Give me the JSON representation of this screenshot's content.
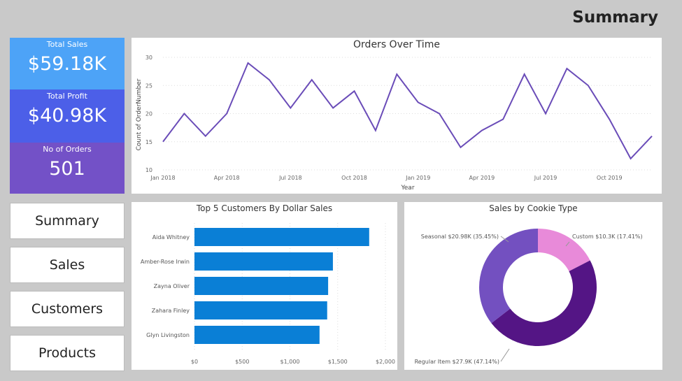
{
  "header": {
    "title": "Summary"
  },
  "kpis": [
    {
      "label": "Total Sales",
      "value": "$59.18K",
      "color": "#4da3f7"
    },
    {
      "label": "Total Profit",
      "value": "$40.98K",
      "color": "#4c5fe8"
    },
    {
      "label": "No of Orders",
      "value": "501",
      "color": "#7351c7"
    }
  ],
  "nav": [
    {
      "label": "Summary"
    },
    {
      "label": "Sales"
    },
    {
      "label": "Customers"
    },
    {
      "label": "Products"
    }
  ],
  "chart_data": [
    {
      "type": "line",
      "title": "Orders Over Time",
      "xlabel": "Year",
      "ylabel": "Count of OrderNumber",
      "ylim": [
        10,
        30
      ],
      "yticks": [
        10,
        15,
        20,
        25,
        30
      ],
      "grid": true,
      "color": "#6a4cb8",
      "x": [
        "Jan 2018",
        "Feb 2018",
        "Mar 2018",
        "Apr 2018",
        "May 2018",
        "Jun 2018",
        "Jul 2018",
        "Aug 2018",
        "Sep 2018",
        "Oct 2018",
        "Nov 2018",
        "Dec 2018",
        "Jan 2019",
        "Feb 2019",
        "Mar 2019",
        "Apr 2019",
        "May 2019",
        "Jun 2019",
        "Jul 2019",
        "Aug 2019",
        "Sep 2019",
        "Oct 2019",
        "Nov 2019",
        "Dec 2019"
      ],
      "xticks": [
        "Jan 2018",
        "Apr 2018",
        "Jul 2018",
        "Oct 2018",
        "Jan 2019",
        "Apr 2019",
        "Jul 2019",
        "Oct 2019"
      ],
      "values": [
        15,
        20,
        16,
        20,
        29,
        26,
        21,
        26,
        21,
        24,
        17,
        27,
        22,
        20,
        14,
        17,
        19,
        27,
        20,
        28,
        25,
        19,
        12,
        16
      ]
    },
    {
      "type": "bar",
      "orientation": "horizontal",
      "title": "Top 5 Customers By Dollar Sales",
      "color": "#0a7fd6",
      "categories": [
        "Aida Whitney",
        "Amber-Rose Irwin",
        "Zayna Oliver",
        "Zahara Finley",
        "Glyn Livingston"
      ],
      "values": [
        1830,
        1450,
        1400,
        1390,
        1310
      ],
      "xlim": [
        0,
        2000
      ],
      "xticks": [
        "$0",
        "$500",
        "$1,000",
        "$1,500",
        "$2,000"
      ]
    },
    {
      "type": "pie",
      "subtype": "donut",
      "title": "Sales by Cookie Type",
      "slices": [
        {
          "name": "Custom",
          "value": 10.3,
          "percent": 17.41,
          "label": "Custom $10.3K (17.41%)",
          "color": "#e88ad9"
        },
        {
          "name": "Regular Item",
          "value": 27.9,
          "percent": 47.14,
          "label": "Regular Item $27.9K (47.14%)",
          "color": "#541585"
        },
        {
          "name": "Seasonal",
          "value": 20.98,
          "percent": 35.45,
          "label": "Seasonal $20.98K (35.45%)",
          "color": "#7350c0"
        }
      ]
    }
  ]
}
